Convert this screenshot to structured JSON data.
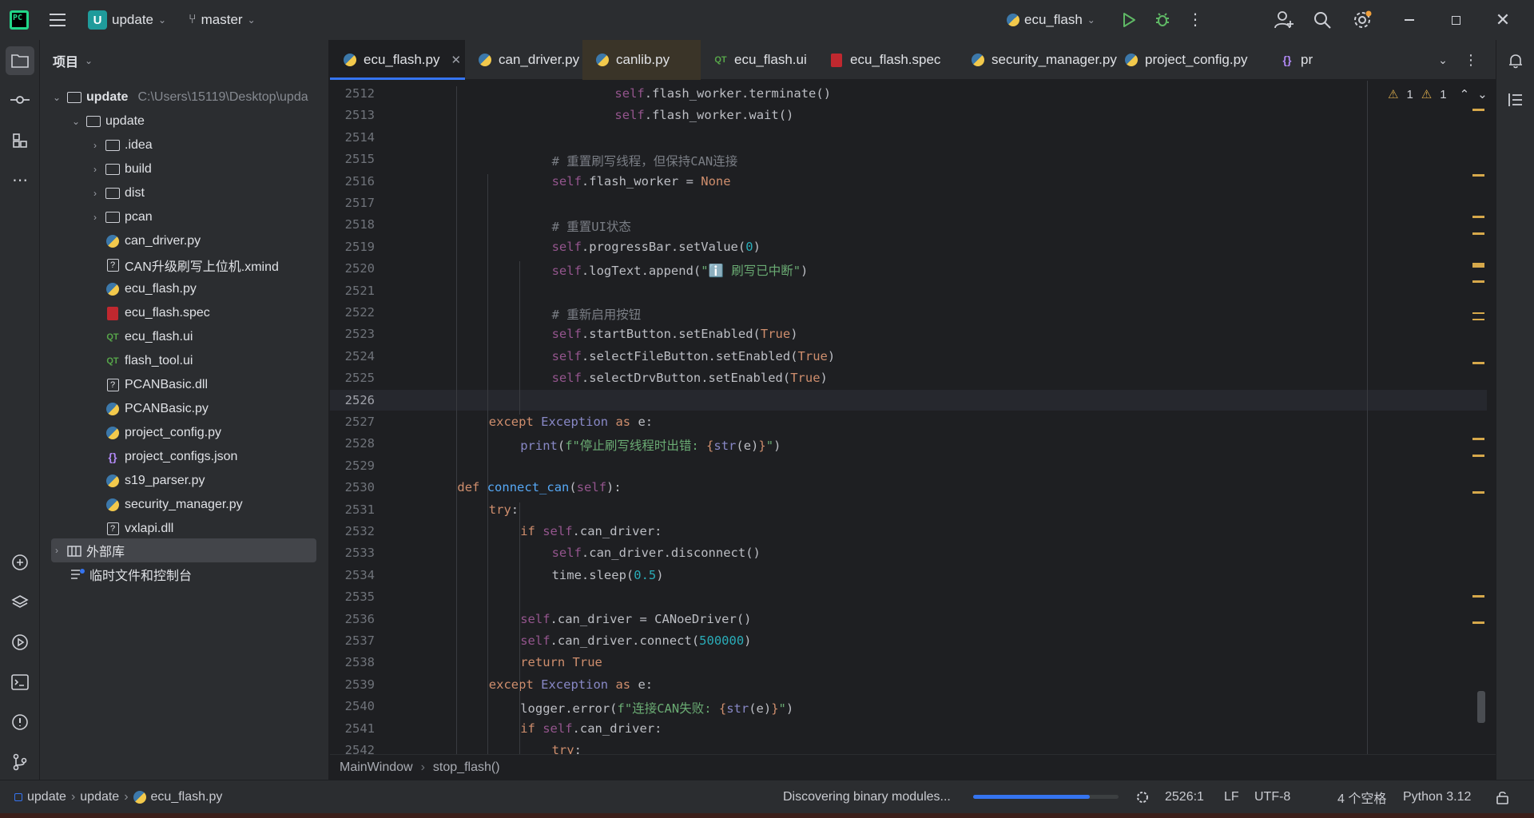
{
  "titlebar": {
    "project_badge": "U",
    "project_name": "update",
    "branch": "master",
    "run_config": "ecu_flash",
    "colors": {
      "accent": "#3574f0",
      "run": "#5fb865",
      "debug": "#5fb865",
      "badge": "#1f9b9b"
    }
  },
  "project_panel": {
    "title": "项目",
    "root_name": "update",
    "root_path": "C:\\Users\\15119\\Desktop\\upda",
    "inner_folder": "update",
    "folders": [
      ".idea",
      "build",
      "dist",
      "pcan"
    ],
    "files": [
      {
        "name": "can_driver.py",
        "icon": "python-icon"
      },
      {
        "name": "CAN升级刷写上位机.xmind",
        "icon": "unknown-file-icon"
      },
      {
        "name": "ecu_flash.py",
        "icon": "python-icon"
      },
      {
        "name": "ecu_flash.spec",
        "icon": "spec-icon"
      },
      {
        "name": "ecu_flash.ui",
        "icon": "qt-ui-icon"
      },
      {
        "name": "flash_tool.ui",
        "icon": "qt-ui-icon"
      },
      {
        "name": "PCANBasic.dll",
        "icon": "unknown-file-icon"
      },
      {
        "name": "PCANBasic.py",
        "icon": "python-icon"
      },
      {
        "name": "project_config.py",
        "icon": "python-icon"
      },
      {
        "name": "project_configs.json",
        "icon": "json-icon"
      },
      {
        "name": "s19_parser.py",
        "icon": "python-icon"
      },
      {
        "name": "security_manager.py",
        "icon": "python-icon"
      },
      {
        "name": "vxlapi.dll",
        "icon": "unknown-file-icon"
      }
    ],
    "external_libs": "外部库",
    "scratches": "临时文件和控制台"
  },
  "tabs": [
    {
      "label": "ecu_flash.py",
      "icon": "python-icon"
    },
    {
      "label": "can_driver.py",
      "icon": "python-icon"
    },
    {
      "label": "canlib.py",
      "icon": "python-icon"
    },
    {
      "label": "ecu_flash.ui",
      "icon": "qt-ui-icon"
    },
    {
      "label": "ecu_flash.spec",
      "icon": "spec-icon"
    },
    {
      "label": "security_manager.py",
      "icon": "python-icon"
    },
    {
      "label": "project_config.py",
      "icon": "python-icon"
    },
    {
      "label": "pr",
      "icon": "json-icon"
    }
  ],
  "editor": {
    "warnings_a": "1",
    "warnings_b": "1",
    "current_line": 2526,
    "lines": [
      {
        "n": 2512,
        "indent": 6,
        "tokens": [
          [
            "self",
            "self"
          ],
          [
            ".flash_worker.terminate()",
            "plain"
          ]
        ]
      },
      {
        "n": 2513,
        "indent": 6,
        "tokens": [
          [
            "self",
            "self"
          ],
          [
            ".flash_worker.wait()",
            "plain"
          ]
        ]
      },
      {
        "n": 2514,
        "indent": 0,
        "tokens": []
      },
      {
        "n": 2515,
        "indent": 4,
        "tokens": [
          [
            "# 重置刷写线程，但保持CAN连接",
            "cmt"
          ]
        ]
      },
      {
        "n": 2516,
        "indent": 4,
        "tokens": [
          [
            "self",
            "self"
          ],
          [
            ".flash_worker = ",
            "plain"
          ],
          [
            "None",
            "kw"
          ]
        ]
      },
      {
        "n": 2517,
        "indent": 0,
        "tokens": []
      },
      {
        "n": 2518,
        "indent": 4,
        "tokens": [
          [
            "# 重置UI状态",
            "cmt"
          ]
        ]
      },
      {
        "n": 2519,
        "indent": 4,
        "tokens": [
          [
            "self",
            "self"
          ],
          [
            ".progressBar.setValue(",
            "plain"
          ],
          [
            "0",
            "num"
          ],
          [
            ")",
            "plain"
          ]
        ]
      },
      {
        "n": 2520,
        "indent": 4,
        "tokens": [
          [
            "self",
            "self"
          ],
          [
            ".logText.append(",
            "plain"
          ],
          [
            "\"ℹ️ 刷写已中断\"",
            "str"
          ],
          [
            ")",
            "plain"
          ]
        ]
      },
      {
        "n": 2521,
        "indent": 0,
        "tokens": []
      },
      {
        "n": 2522,
        "indent": 4,
        "tokens": [
          [
            "# 重新启用按钮",
            "cmt"
          ]
        ]
      },
      {
        "n": 2523,
        "indent": 4,
        "tokens": [
          [
            "self",
            "self"
          ],
          [
            ".startButton.setEnabled(",
            "plain"
          ],
          [
            "True",
            "kw"
          ],
          [
            ")",
            "plain"
          ]
        ]
      },
      {
        "n": 2524,
        "indent": 4,
        "tokens": [
          [
            "self",
            "self"
          ],
          [
            ".selectFileButton.setEnabled(",
            "plain"
          ],
          [
            "True",
            "kw"
          ],
          [
            ")",
            "plain"
          ]
        ]
      },
      {
        "n": 2525,
        "indent": 4,
        "tokens": [
          [
            "self",
            "self"
          ],
          [
            ".selectDrvButton.setEnabled(",
            "plain"
          ],
          [
            "True",
            "kw"
          ],
          [
            ")",
            "plain"
          ]
        ]
      },
      {
        "n": 2526,
        "indent": 0,
        "tokens": []
      },
      {
        "n": 2527,
        "indent": 2,
        "tokens": [
          [
            "except ",
            "kw"
          ],
          [
            "Exception ",
            "builtin"
          ],
          [
            "as ",
            "kw"
          ],
          [
            "e:",
            "plain"
          ]
        ]
      },
      {
        "n": 2528,
        "indent": 3,
        "tokens": [
          [
            "print",
            "builtin"
          ],
          [
            "(",
            "plain"
          ],
          [
            "f\"停止刷写线程时出错: ",
            "str"
          ],
          [
            "{",
            "kw"
          ],
          [
            "str",
            "builtin"
          ],
          [
            "(e)",
            "plain"
          ],
          [
            "}",
            "kw"
          ],
          [
            "\"",
            "str"
          ],
          [
            ")",
            "plain"
          ]
        ]
      },
      {
        "n": 2529,
        "indent": 0,
        "tokens": []
      },
      {
        "n": 2530,
        "indent": 1,
        "tokens": [
          [
            "def ",
            "kw"
          ],
          [
            "connect_can",
            "fn"
          ],
          [
            "(",
            "plain"
          ],
          [
            "self",
            "self"
          ],
          [
            "):",
            "plain"
          ]
        ]
      },
      {
        "n": 2531,
        "indent": 2,
        "tokens": [
          [
            "try",
            "kw"
          ],
          [
            ":",
            "plain"
          ]
        ]
      },
      {
        "n": 2532,
        "indent": 3,
        "tokens": [
          [
            "if ",
            "kw"
          ],
          [
            "self",
            "self"
          ],
          [
            ".can_driver:",
            "plain"
          ]
        ]
      },
      {
        "n": 2533,
        "indent": 4,
        "tokens": [
          [
            "self",
            "self"
          ],
          [
            ".can_driver.disconnect()",
            "plain"
          ]
        ]
      },
      {
        "n": 2534,
        "indent": 4,
        "tokens": [
          [
            "time.sleep(",
            "plain"
          ],
          [
            "0.5",
            "num"
          ],
          [
            ")",
            "plain"
          ]
        ]
      },
      {
        "n": 2535,
        "indent": 0,
        "tokens": []
      },
      {
        "n": 2536,
        "indent": 3,
        "tokens": [
          [
            "self",
            "self"
          ],
          [
            ".can_driver = CANoeDriver()",
            "plain"
          ]
        ]
      },
      {
        "n": 2537,
        "indent": 3,
        "tokens": [
          [
            "self",
            "self"
          ],
          [
            ".can_driver.connect(",
            "plain"
          ],
          [
            "500000",
            "num"
          ],
          [
            ")",
            "plain"
          ]
        ]
      },
      {
        "n": 2538,
        "indent": 3,
        "tokens": [
          [
            "return ",
            "kw"
          ],
          [
            "True",
            "kw"
          ]
        ]
      },
      {
        "n": 2539,
        "indent": 2,
        "tokens": [
          [
            "except ",
            "kw"
          ],
          [
            "Exception ",
            "builtin"
          ],
          [
            "as ",
            "kw"
          ],
          [
            "e:",
            "plain"
          ]
        ]
      },
      {
        "n": 2540,
        "indent": 3,
        "tokens": [
          [
            "logger.error(",
            "plain"
          ],
          [
            "f\"连接CAN失败: ",
            "str"
          ],
          [
            "{",
            "kw"
          ],
          [
            "str",
            "builtin"
          ],
          [
            "(e)",
            "plain"
          ],
          [
            "}",
            "kw"
          ],
          [
            "\"",
            "str"
          ],
          [
            ")",
            "plain"
          ]
        ]
      },
      {
        "n": 2541,
        "indent": 3,
        "tokens": [
          [
            "if ",
            "kw"
          ],
          [
            "self",
            "self"
          ],
          [
            ".can_driver:",
            "plain"
          ]
        ]
      },
      {
        "n": 2542,
        "indent": 4,
        "tokens": [
          [
            "try",
            "kw"
          ],
          [
            ":",
            "plain"
          ]
        ]
      }
    ]
  },
  "breadcrumb": [
    "MainWindow",
    "stop_flash()"
  ],
  "statusbar": {
    "crumbs": [
      "update",
      "update",
      "ecu_flash.py"
    ],
    "task": "Discovering binary modules...",
    "progress": 0.8,
    "position": "2526:1",
    "line_sep": "LF",
    "encoding": "UTF-8",
    "indent": "4 个空格",
    "interpreter": "Python 3.12"
  }
}
